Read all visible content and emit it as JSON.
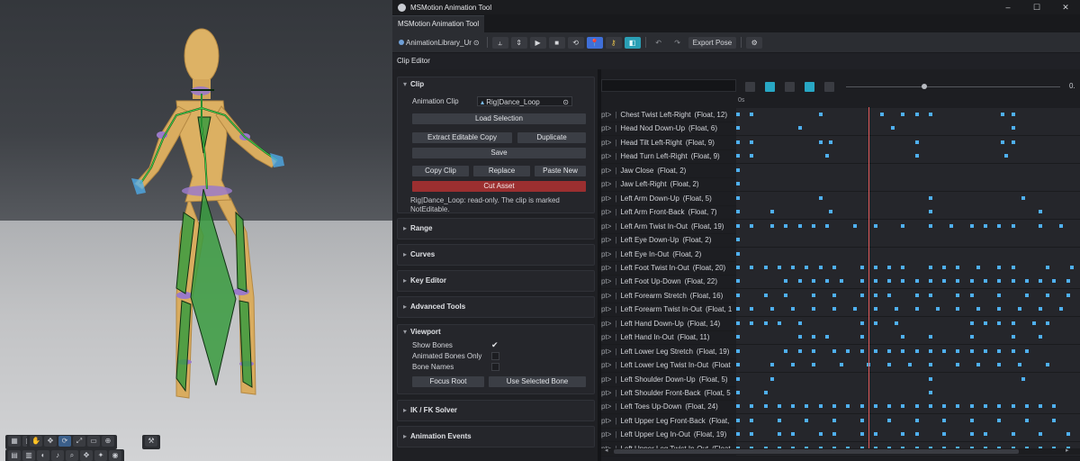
{
  "window": {
    "title": "MSMotion Animation Tool",
    "controls": [
      "–",
      "☐",
      "✕"
    ]
  },
  "tab": {
    "label": "MSMotion Animation Tool"
  },
  "toolbar": {
    "library_label": "AnimationLibrary_Ur",
    "export_label": "Export Pose"
  },
  "clip_editor": {
    "title": "Clip Editor"
  },
  "clip_panel": {
    "title": "Clip",
    "animation_clip_label": "Animation Clip",
    "animation_clip_value": "Rig|Dance_Loop",
    "load_selection": "Load Selection",
    "extract_editable_copy": "Extract Editable Copy",
    "duplicate": "Duplicate",
    "save": "Save",
    "copy_clip": "Copy Clip",
    "replace": "Replace",
    "paste_new": "Paste New",
    "cut_asset": "Cut Asset",
    "note": "Rig|Dance_Loop: read-only. The clip is marked NotEditable."
  },
  "sections": {
    "range": "Range",
    "curves": "Curves",
    "key_editor": "Key Editor",
    "advanced_tools": "Advanced Tools",
    "ik_fk_solver": "IK / FK Solver",
    "animation_events": "Animation Events"
  },
  "viewport_panel": {
    "title": "Viewport",
    "show_bones": "Show Bones",
    "show_bones_checked": true,
    "animated_bones_only": "Animated Bones Only",
    "bone_names": "Bone Names",
    "focus_root": "Focus Root",
    "use_selected_bone": "Use Selected Bone"
  },
  "timeline": {
    "ruler_start": "0s",
    "slider_end": "0.",
    "row_prefix": "pt>",
    "rows": [
      {
        "name": "Chest Twist Left-Right",
        "info": "(Float, 12)",
        "keys": [
          0.0,
          0.04,
          0.24,
          0.42,
          0.48,
          0.52,
          0.56,
          0.77,
          0.8
        ]
      },
      {
        "name": "Head Nod Down-Up",
        "info": "(Float, 6)",
        "keys": [
          0.0,
          0.18,
          0.45,
          0.8
        ]
      },
      {
        "name": "Head Tilt Left-Right",
        "info": "(Float, 9)",
        "keys": [
          0.0,
          0.04,
          0.24,
          0.27,
          0.52,
          0.77,
          0.8
        ]
      },
      {
        "name": "Head Turn Left-Right",
        "info": "(Float, 9)",
        "keys": [
          0.0,
          0.04,
          0.26,
          0.52,
          0.78
        ]
      },
      {
        "name": "Jaw Close",
        "info": "(Float, 2)",
        "keys": [
          0.0
        ]
      },
      {
        "name": "Jaw Left-Right",
        "info": "(Float, 2)",
        "keys": [
          0.0
        ]
      },
      {
        "name": "Left Arm Down-Up",
        "info": "(Float, 5)",
        "keys": [
          0.0,
          0.24,
          0.56,
          0.83
        ]
      },
      {
        "name": "Left Arm Front-Back",
        "info": "(Float, 7)",
        "keys": [
          0.0,
          0.1,
          0.27,
          0.56,
          0.88
        ]
      },
      {
        "name": "Left Arm Twist In-Out",
        "info": "(Float, 19)",
        "keys": [
          0.0,
          0.04,
          0.1,
          0.14,
          0.18,
          0.22,
          0.26,
          0.34,
          0.4,
          0.48,
          0.56,
          0.62,
          0.68,
          0.72,
          0.76,
          0.8,
          0.88,
          0.94
        ]
      },
      {
        "name": "Left Eye Down-Up",
        "info": "(Float, 2)",
        "keys": [
          0.0
        ]
      },
      {
        "name": "Left Eye In-Out",
        "info": "(Float, 2)",
        "keys": [
          0.0
        ]
      },
      {
        "name": "Left Foot Twist In-Out",
        "info": "(Float, 20)",
        "keys": [
          0.0,
          0.04,
          0.08,
          0.12,
          0.16,
          0.2,
          0.24,
          0.28,
          0.36,
          0.4,
          0.44,
          0.48,
          0.56,
          0.6,
          0.64,
          0.7,
          0.76,
          0.8,
          0.9,
          0.97
        ]
      },
      {
        "name": "Left Foot Up-Down",
        "info": "(Float, 22)",
        "keys": [
          0.0,
          0.14,
          0.18,
          0.22,
          0.26,
          0.3,
          0.36,
          0.4,
          0.44,
          0.48,
          0.52,
          0.56,
          0.6,
          0.64,
          0.68,
          0.72,
          0.76,
          0.8,
          0.84,
          0.88,
          0.92,
          0.96
        ]
      },
      {
        "name": "Left Forearm Stretch",
        "info": "(Float, 16)",
        "keys": [
          0.0,
          0.08,
          0.14,
          0.22,
          0.28,
          0.36,
          0.4,
          0.44,
          0.52,
          0.56,
          0.64,
          0.68,
          0.76,
          0.84,
          0.9,
          0.96
        ]
      },
      {
        "name": "Left Forearm Twist In-Out",
        "info": "(Float, 1",
        "keys": [
          0.0,
          0.04,
          0.1,
          0.16,
          0.22,
          0.28,
          0.34,
          0.4,
          0.46,
          0.52,
          0.58,
          0.64,
          0.7,
          0.76,
          0.82,
          0.88,
          0.94
        ]
      },
      {
        "name": "Left Hand Down-Up",
        "info": "(Float, 14)",
        "keys": [
          0.0,
          0.04,
          0.08,
          0.12,
          0.18,
          0.36,
          0.4,
          0.46,
          0.68,
          0.72,
          0.76,
          0.8,
          0.86,
          0.9
        ]
      },
      {
        "name": "Left Hand In-Out",
        "info": "(Float, 11)",
        "keys": [
          0.0,
          0.18,
          0.22,
          0.26,
          0.36,
          0.48,
          0.56,
          0.68,
          0.8,
          0.88
        ]
      },
      {
        "name": "Left Lower Leg Stretch",
        "info": "(Float, 19)",
        "keys": [
          0.0,
          0.14,
          0.18,
          0.22,
          0.28,
          0.32,
          0.36,
          0.4,
          0.44,
          0.48,
          0.52,
          0.56,
          0.6,
          0.64,
          0.68,
          0.72,
          0.76,
          0.8,
          0.84
        ]
      },
      {
        "name": "Left Lower Leg Twist In-Out",
        "info": "(Float",
        "keys": [
          0.0,
          0.1,
          0.16,
          0.22,
          0.3,
          0.38,
          0.44,
          0.5,
          0.56,
          0.64,
          0.7,
          0.76,
          0.82,
          0.9
        ]
      },
      {
        "name": "Left Shoulder Down-Up",
        "info": "(Float, 5)",
        "keys": [
          0.0,
          0.1,
          0.56,
          0.83
        ]
      },
      {
        "name": "Left Shoulder Front-Back",
        "info": "(Float, 5",
        "keys": [
          0.0,
          0.08,
          0.56
        ]
      },
      {
        "name": "Left Toes Up-Down",
        "info": "(Float, 24)",
        "keys": [
          0.0,
          0.04,
          0.08,
          0.12,
          0.16,
          0.2,
          0.24,
          0.28,
          0.32,
          0.36,
          0.4,
          0.44,
          0.48,
          0.52,
          0.56,
          0.6,
          0.64,
          0.68,
          0.72,
          0.76,
          0.8,
          0.84,
          0.88,
          0.92
        ]
      },
      {
        "name": "Left Upper Leg Front-Back",
        "info": "(Float,",
        "keys": [
          0.0,
          0.04,
          0.12,
          0.2,
          0.28,
          0.36,
          0.44,
          0.52,
          0.6,
          0.68,
          0.76,
          0.84,
          0.92
        ]
      },
      {
        "name": "Left Upper Leg In-Out",
        "info": "(Float, 19)",
        "keys": [
          0.0,
          0.04,
          0.12,
          0.16,
          0.24,
          0.28,
          0.36,
          0.4,
          0.48,
          0.52,
          0.6,
          0.68,
          0.72,
          0.8,
          0.88,
          0.96
        ]
      },
      {
        "name": "Left Upper Leg Twist In-Out",
        "info": "(Float",
        "keys": [
          0.0,
          0.04,
          0.08,
          0.12,
          0.16,
          0.2,
          0.24,
          0.28,
          0.32,
          0.36,
          0.4,
          0.44,
          0.48,
          0.52,
          0.56,
          0.6,
          0.64,
          0.68,
          0.72,
          0.76,
          0.8,
          0.84,
          0.88,
          0.92,
          0.96
        ]
      }
    ]
  }
}
